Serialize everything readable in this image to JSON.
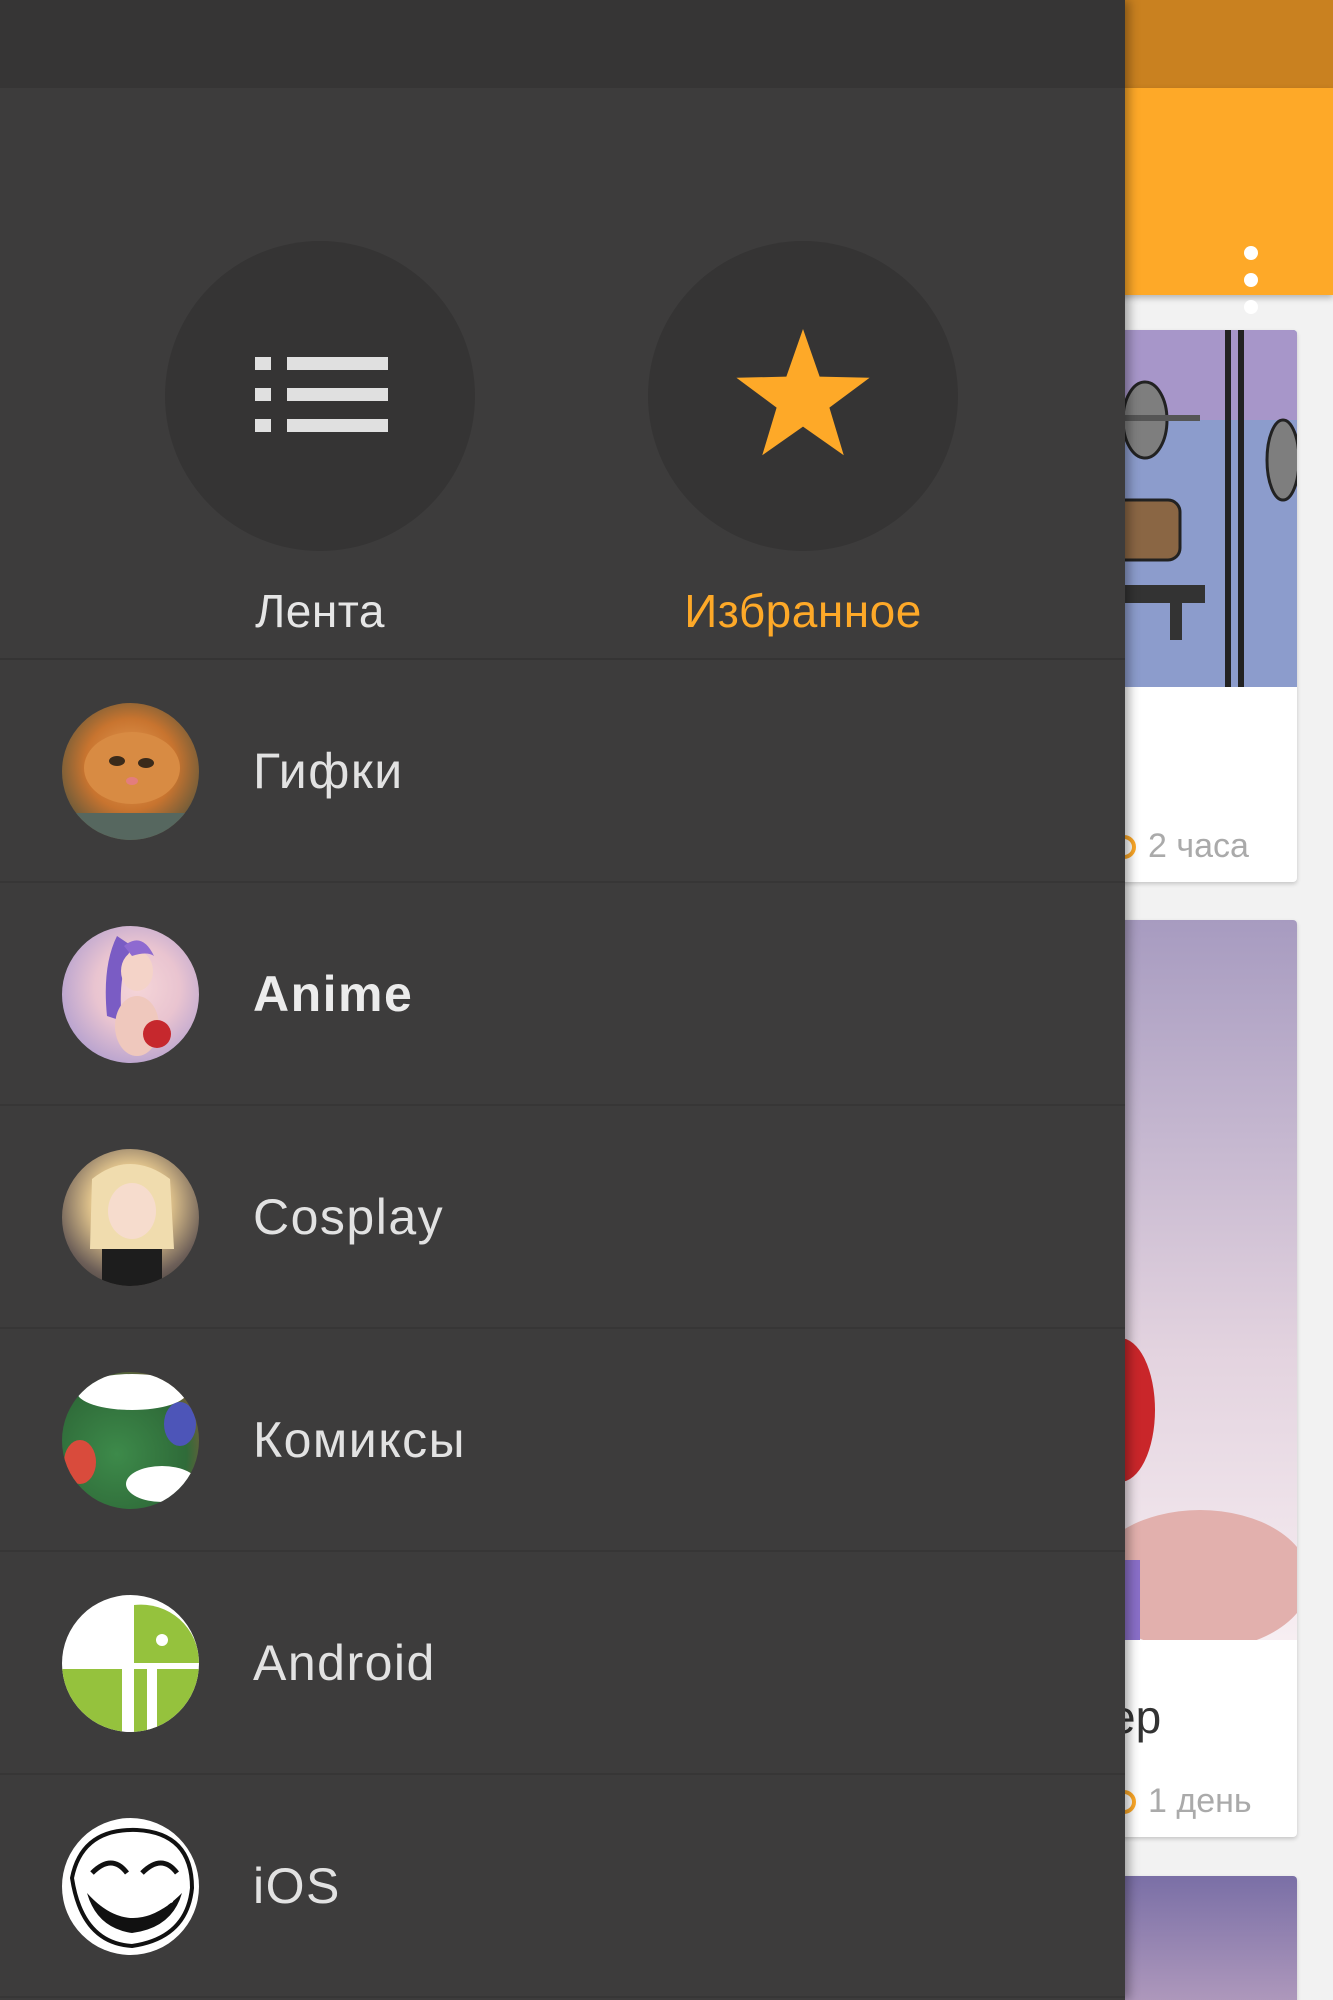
{
  "app": {
    "overflow_icon": "more-vertical-icon",
    "cards": [
      {
        "time": "2 часа"
      },
      {
        "title_fragment": "ер",
        "time": "1 день"
      }
    ]
  },
  "drawer": {
    "header": {
      "feed": {
        "label": "Лента",
        "icon": "list-icon",
        "color": "#e6e6e6"
      },
      "favorites": {
        "label": "Избранное",
        "icon": "star-icon",
        "color": "#fea928"
      }
    },
    "items": [
      {
        "label": "Гифки",
        "icon": "cat-avatar"
      },
      {
        "label": "Anime",
        "icon": "anime-avatar",
        "active": true
      },
      {
        "label": "Cosplay",
        "icon": "cosplay-avatar"
      },
      {
        "label": "Комиксы",
        "icon": "comics-avatar"
      },
      {
        "label": "Android",
        "icon": "android-avatar"
      },
      {
        "label": "iOS",
        "icon": "trollface-avatar"
      }
    ]
  },
  "colors": {
    "accent": "#fea928",
    "drawer_bg": "#3d3c3c",
    "statusbar_app": "#c98120"
  }
}
